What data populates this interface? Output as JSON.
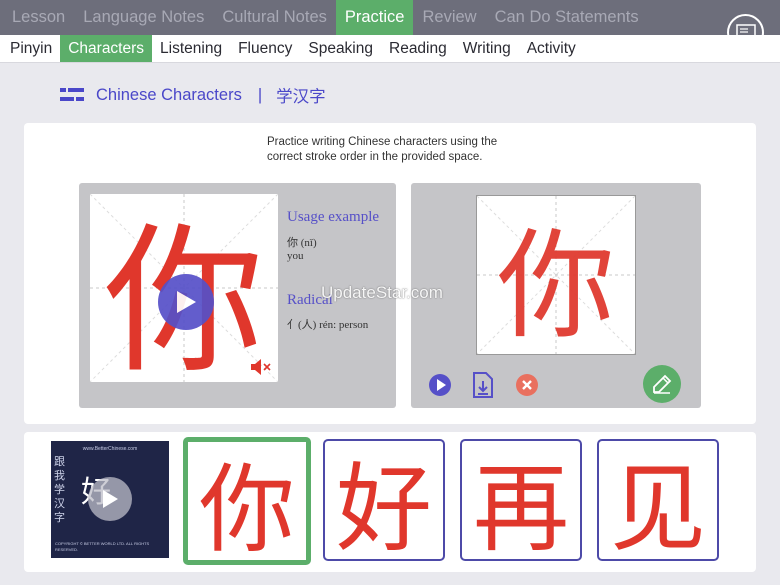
{
  "top_nav": {
    "tabs": [
      {
        "label": "Lesson"
      },
      {
        "label": "Language Notes"
      },
      {
        "label": "Cultural Notes"
      },
      {
        "label": "Practice",
        "active": true
      },
      {
        "label": "Review"
      },
      {
        "label": "Can Do Statements"
      }
    ]
  },
  "sub_nav": {
    "tabs": [
      {
        "label": "Pinyin"
      },
      {
        "label": "Characters",
        "active": true
      },
      {
        "label": "Listening"
      },
      {
        "label": "Fluency"
      },
      {
        "label": "Speaking"
      },
      {
        "label": "Reading"
      },
      {
        "label": "Writing"
      },
      {
        "label": "Activity"
      }
    ]
  },
  "section": {
    "title": "Chinese Characters",
    "separator": "|",
    "title_zh": "学汉字"
  },
  "instructions": "Practice writing Chinese characters using the correct stroke order in the provided space.",
  "demo": {
    "character": "你",
    "usage_title": "Usage example",
    "usage_char": "你 (nǐ)",
    "usage_meaning": "you",
    "radical_title": "Radical",
    "radical_value": "亻(人) rén: person"
  },
  "practice": {
    "character": "你"
  },
  "watermark": "UpdateStar.com",
  "video": {
    "url": "www.BetterChinese.com",
    "vertical_text": "跟我学汉字",
    "character": "好",
    "footer": "COPYRIGHT © BETTER WORLD LTD. ALL RIGHTS RESERVED."
  },
  "character_cards": [
    {
      "character": "你",
      "selected": true
    },
    {
      "character": "好"
    },
    {
      "character": "再"
    },
    {
      "character": "见"
    }
  ],
  "colors": {
    "nav_bg": "#6d6e7b",
    "accent_green": "#5cae6a",
    "accent_purple": "#5650c8",
    "character_red": "#e0372c"
  },
  "icons": {
    "menu": "panel-menu-icon",
    "section": "lines-icon",
    "play": "play-icon",
    "mute": "speaker-muted-icon",
    "download": "download-icon",
    "clear": "close-icon",
    "draw": "pencil-icon"
  }
}
